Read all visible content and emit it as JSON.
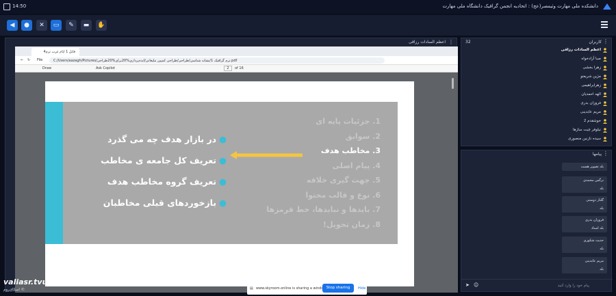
{
  "top_bar": {
    "time": "14:50",
    "title": "دانشکده ملی مهارت وثیمصر(عج) : اتحادیه انجمن گرافیک دانشگاه ملی مهارت"
  },
  "share_panel": {
    "title": "اعظم السادات رزاقی"
  },
  "browser": {
    "tab_title": "فایل 1 ایام غرب ترم4",
    "file_label": "File",
    "url": "C:/Users/aazagh/Pictures/ترم گرافیک 1/نشانه شناسی/طراحی/طراحی کمپین تبلیغاتی/ایده‌پردازی%20برای%20طراحی.pdf",
    "draw_label": "Draw",
    "copilot_label": "Ask Copilot",
    "page_num": "2",
    "page_total": "of 16"
  },
  "slide": {
    "outline": [
      "1.  جزئیات پایه ای",
      "2.  سوابق",
      "3.  مخاطب هدف",
      "4.  پیام اصلی",
      "5.  جهت گیری خلاقه",
      "6.  نوع و قالب محتوا",
      "7.  بایدها و نبایدها، خط قرمزها",
      "8.  زمان تحویل!"
    ],
    "bullets": [
      "در بازار هدف چه می گذرد",
      "تعریف کل جامعه ی مخاطب",
      "تعریف گروه مخاطب هدف",
      "بازخوردهای قبلی مخاطبان"
    ]
  },
  "participants": {
    "title": "کاربران",
    "count": "32",
    "users": [
      "اعظم السادات رزاقی",
      "صبا آزادخواه",
      "زهرا بخشی",
      "مژین شریعتو",
      "زهرابراهیمی",
      "الهه احمدیان",
      "فروزان بدری",
      "مریم عابدینی",
      "خوشقدم 2",
      "نیلوفر چیت سازها",
      "سیده نازنین منصوری"
    ]
  },
  "chat": {
    "title": "پیامها",
    "messages": [
      {
        "line1": "بله تصویر هست",
        "line2": ""
      },
      {
        "line1": "نرگس محمدی",
        "line2": "بله"
      },
      {
        "line1": "گلناز دوستی",
        "line2": "بله"
      },
      {
        "line1": "فروزان بدری",
        "line2": "بله استاد"
      },
      {
        "line1": "حدیث شکوری",
        "line2": "بله"
      },
      {
        "line1": "مریم عابدینی",
        "line2": "بله"
      }
    ],
    "input_placeholder": "پیام خود را وارد کنید"
  },
  "share_banner": {
    "text": "www.skyroom.online is sharing a window.",
    "stop_label": "Stop sharing",
    "hide_label": "Hide"
  },
  "watermark": "valiasr.tvu.ac.ir",
  "brand": "اسکای‌روم ©",
  "colors": {
    "accent": "#1a73e8",
    "slide_stripe": "#3bbdd6",
    "arrow": "#f4c542"
  }
}
